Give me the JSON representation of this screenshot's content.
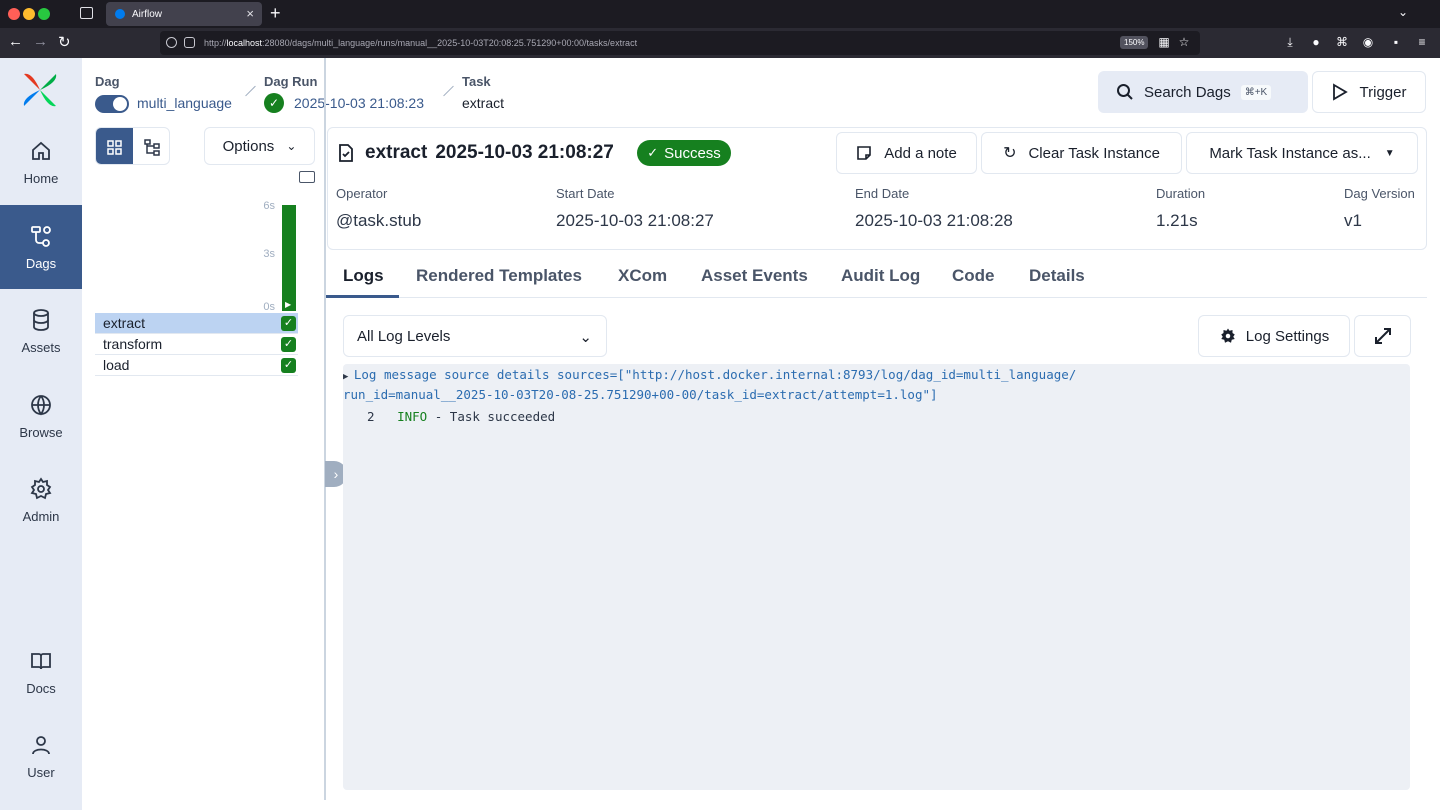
{
  "browser": {
    "tab_title": "Airflow",
    "url_prefix": "http://",
    "url_host": "localhost",
    "url_rest": ":28080/dags/multi_language/runs/manual__2025-10-03T20:08:25.751290+00:00/tasks/extract",
    "zoom": "150%"
  },
  "nav": {
    "items": [
      {
        "label": "Home",
        "icon": "home-icon"
      },
      {
        "label": "Dags",
        "icon": "dags-icon"
      },
      {
        "label": "Assets",
        "icon": "assets-icon"
      },
      {
        "label": "Browse",
        "icon": "globe-icon"
      },
      {
        "label": "Admin",
        "icon": "gear-icon"
      },
      {
        "label": "Docs",
        "icon": "book-icon"
      },
      {
        "label": "User",
        "icon": "user-icon"
      }
    ],
    "active": "Dags"
  },
  "breadcrumb": {
    "dag_label": "Dag",
    "dag_value": "multi_language",
    "run_label": "Dag Run",
    "run_value": "2025-10-03 21:08:23",
    "task_label": "Task",
    "task_value": "extract"
  },
  "header_actions": {
    "search_label": "Search Dags",
    "search_shortcut": "⌘+K",
    "trigger_label": "Trigger"
  },
  "grid_panel": {
    "options_label": "Options",
    "y_ticks": [
      "6s",
      "3s",
      "0s"
    ],
    "tasks": [
      "extract",
      "transform",
      "load"
    ],
    "selected_task": "extract",
    "run_state": "success"
  },
  "task_instance": {
    "name": "extract",
    "timestamp": "2025-10-03 21:08:27",
    "status": "Success",
    "actions": {
      "add_note": "Add a note",
      "clear": "Clear Task Instance",
      "mark": "Mark Task Instance as..."
    },
    "meta": [
      {
        "label": "Operator",
        "value": "@task.stub"
      },
      {
        "label": "Start Date",
        "value": "2025-10-03 21:08:27"
      },
      {
        "label": "End Date",
        "value": "2025-10-03 21:08:28"
      },
      {
        "label": "Duration",
        "value": "1.21s"
      },
      {
        "label": "Dag Version",
        "value": "v1"
      }
    ]
  },
  "tabs": [
    "Logs",
    "Rendered Templates",
    "XCom",
    "Asset Events",
    "Audit Log",
    "Code",
    "Details"
  ],
  "active_tab": "Logs",
  "logs": {
    "level_select": "All Log Levels",
    "settings_label": "Log Settings",
    "source_line_1": "Log message source details sources=[\"http://host.docker.internal:8793/log/dag_id=multi_language/",
    "source_line_2": "run_id=manual__2025-10-03T20-08-25.751290+00-00/task_id=extract/attempt=1.log\"]",
    "entry": {
      "line_no": "2",
      "level": "INFO",
      "message": "- Task succeeded"
    }
  },
  "colors": {
    "accent": "#3a5a8c",
    "success": "#16801f",
    "sidebar_bg": "#e6ebf5"
  }
}
